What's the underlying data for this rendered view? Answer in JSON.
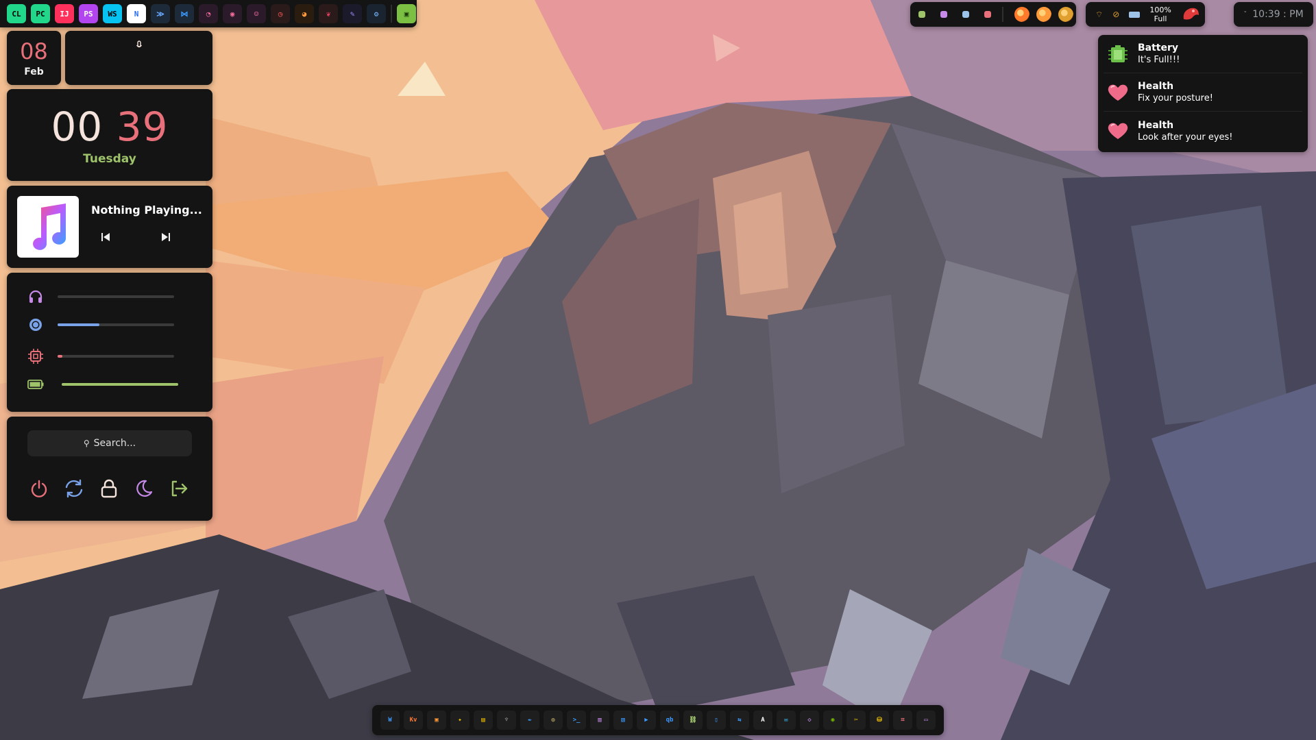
{
  "desktop": {
    "wallpaper_description": "",
    "accent_colors": {
      "pink": "#e8707a",
      "green": "#9ec36b",
      "blue": "#7aa2e8",
      "purple": "#c58ae8",
      "panel_bg": "#141414"
    }
  },
  "top_bar": {
    "apps": [
      {
        "name": "clion-icon",
        "label": "CL",
        "bg": "#21d789",
        "fg": "#000000"
      },
      {
        "name": "pycharm-icon",
        "label": "PC",
        "bg": "#21d789",
        "fg": "#000000"
      },
      {
        "name": "intellij-icon",
        "label": "IJ",
        "bg": "#fe315d",
        "fg": "#ffffff"
      },
      {
        "name": "phpstorm-icon",
        "label": "PS",
        "bg": "#b345f1",
        "fg": "#ffffff"
      },
      {
        "name": "webstorm-icon",
        "label": "WS",
        "bg": "#07c3f2",
        "fg": "#000000"
      },
      {
        "name": "notion-icon",
        "label": "N",
        "bg": "#ffffff",
        "fg": "#2a6df4"
      },
      {
        "name": "vscodium-icon",
        "label": "≫",
        "bg": "#1d2a3a",
        "fg": "#6aa9ff"
      },
      {
        "name": "vscode-icon",
        "label": "⋈",
        "bg": "#1d2a3a",
        "fg": "#3b9bff"
      },
      {
        "name": "chromium-icon",
        "label": "◔",
        "bg": "#2a1a2a",
        "fg": "#f06a9a"
      },
      {
        "name": "github-icon",
        "label": "◉",
        "bg": "#2a1a2a",
        "fg": "#f06a9a"
      },
      {
        "name": "discord-icon",
        "label": "☺",
        "bg": "#2a1a2a",
        "fg": "#f06a9a"
      },
      {
        "name": "speedometer-icon",
        "label": "◷",
        "bg": "#2a1a1a",
        "fg": "#ff5a5a"
      },
      {
        "name": "pie-chart-icon",
        "label": "◕",
        "bg": "#2a1d10",
        "fg": "#ff9a3a"
      },
      {
        "name": "raspberry-icon",
        "label": "❦",
        "bg": "#2a1a1a",
        "fg": "#e04060"
      },
      {
        "name": "pen-tool-icon",
        "label": "✎",
        "bg": "#1a1a2a",
        "fg": "#a08aff"
      },
      {
        "name": "settings-gear-icon",
        "label": "⚙",
        "bg": "#1a2430",
        "fg": "#7ab8ff"
      },
      {
        "name": "terminal-app-icon",
        "label": "▣",
        "bg": "#7bc043",
        "fg": "#1a3a0a"
      }
    ],
    "browsers": [
      {
        "name": "firefox-icon",
        "color": "#ff7a2a"
      },
      {
        "name": "firefox-nightly-icon",
        "color": "#ff9a3a"
      },
      {
        "name": "chrome-icon",
        "color": "#e0a030"
      }
    ],
    "status_dots": [
      {
        "name": "battery-dot-icon",
        "color": "#9ec36b"
      },
      {
        "name": "record-dot-icon",
        "color": "#c58ae8"
      },
      {
        "name": "headphones-dot-icon",
        "color": "#9ec3e8"
      },
      {
        "name": "mail-dot-icon",
        "color": "#e8707a"
      }
    ],
    "battery_percent": "100%",
    "battery_state": "Full",
    "clock_text": "10:39 : PM"
  },
  "date_widget": {
    "day": "08",
    "month": "Feb"
  },
  "clock_widget": {
    "hour": "00",
    "minute": "39",
    "weekday": "Tuesday"
  },
  "media_widget": {
    "title": "Nothing Playing...",
    "art_icon": "music-note-icon"
  },
  "sliders": [
    {
      "name": "volume",
      "icon": "headphones-icon",
      "value": 0.0,
      "color": "#c58ae8"
    },
    {
      "name": "brightness",
      "icon": "brightness-icon",
      "value": 0.36,
      "color": "#7aa2e8"
    },
    {
      "name": "cpu",
      "icon": "cpu-icon",
      "value": 0.04,
      "color": "#e8707a"
    },
    {
      "name": "battery",
      "icon": "battery-icon",
      "value": 1.0,
      "color": "#9ec36b"
    }
  ],
  "search": {
    "placeholder": "Search..."
  },
  "power_actions": [
    {
      "name": "power-button",
      "icon": "power-icon",
      "color": "#e8707a"
    },
    {
      "name": "reboot-button",
      "icon": "refresh-icon",
      "color": "#7aa2e8"
    },
    {
      "name": "lock-button",
      "icon": "lock-icon",
      "color": "#f4e4dc"
    },
    {
      "name": "sleep-button",
      "icon": "moon-icon",
      "color": "#c58ae8"
    },
    {
      "name": "logout-button",
      "icon": "logout-icon",
      "color": "#9ec36b"
    }
  ],
  "notifications": [
    {
      "title": "Battery",
      "body": "It's Full!!!",
      "icon": "battery-chip-icon"
    },
    {
      "title": "Health",
      "body": "Fix your posture!",
      "icon": "heart-icon"
    },
    {
      "title": "Health",
      "body": "Look after your eyes!",
      "icon": "heart-icon"
    }
  ],
  "dock": {
    "apps": [
      {
        "name": "wireshark-icon",
        "label": "W",
        "color": "#3b9bff"
      },
      {
        "name": "kvantum-icon",
        "label": "Kv",
        "color": "#ff7a3a"
      },
      {
        "name": "virtualbox-icon",
        "label": "▣",
        "color": "#ff9a3a"
      },
      {
        "name": "puzzle-icon",
        "label": "✦",
        "color": "#ffcc00"
      },
      {
        "name": "network-icon",
        "label": "▤",
        "color": "#ffcc00"
      },
      {
        "name": "alienware-icon",
        "label": "♆",
        "color": "#8a8a8a"
      },
      {
        "name": "inkscape-icon",
        "label": "✒",
        "color": "#3b9bff"
      },
      {
        "name": "gimp-icon",
        "label": "◍",
        "color": "#b0a060"
      },
      {
        "name": "terminal-icon",
        "label": ">_",
        "color": "#3b9bff"
      },
      {
        "name": "store-icon",
        "label": "▥",
        "color": "#c58ae8"
      },
      {
        "name": "files-icon",
        "label": "▧",
        "color": "#3b9bff"
      },
      {
        "name": "camera-icon",
        "label": "▶",
        "color": "#3b9bff"
      },
      {
        "name": "qbittorrent-icon",
        "label": "qb",
        "color": "#3b9bff"
      },
      {
        "name": "link-icon",
        "label": "⛓",
        "color": "#9ec36b"
      },
      {
        "name": "phone-icon",
        "label": "▯",
        "color": "#3b9bff"
      },
      {
        "name": "remote-icon",
        "label": "⇆",
        "color": "#3b9bff"
      },
      {
        "name": "ascii-icon",
        "label": "A",
        "color": "#ffffff"
      },
      {
        "name": "chat-icon",
        "label": "✉",
        "color": "#3bc3ff"
      },
      {
        "name": "vector-icon",
        "label": "◇",
        "color": "#c58ae8"
      },
      {
        "name": "nvidia-icon",
        "label": "◉",
        "color": "#76b900"
      },
      {
        "name": "photo-editor-icon",
        "label": "✂",
        "color": "#ffcc00"
      },
      {
        "name": "disks-icon",
        "label": "⛁",
        "color": "#ffcc00"
      },
      {
        "name": "crop-icon",
        "label": "⌗",
        "color": "#e8707a"
      },
      {
        "name": "monitor-icon",
        "label": "▭",
        "color": "#c58ae8"
      }
    ]
  }
}
